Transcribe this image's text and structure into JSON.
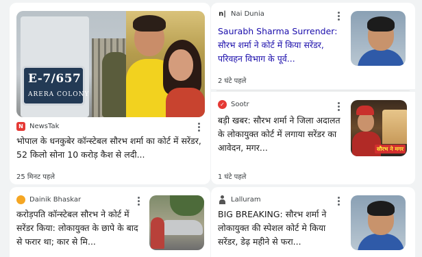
{
  "articles": [
    {
      "source": "NewsTak",
      "source_icon": "newstak-logo-icon",
      "headline": "भोपाल के धनकुबेर कॉन्स्टेबल सौरभ शर्मा का कोर्ट में सरेंडर, 52 किलो सोना 10 करोड़ कैश से लदी...",
      "time": "25 मिनट पहले",
      "image": {
        "plate_number": "E-7/657",
        "plate_text": "ARERA COLONY"
      }
    },
    {
      "source": "Nai Dunia",
      "source_icon": "naidunia-logo-icon",
      "headline": "Saurabh Sharma Surrender: सौरभ शर्मा ने कोर्ट में किया सरेंडर, परिवहन विभाग के पूर्व...",
      "time": "2 घंटे पहले"
    },
    {
      "source": "Sootr",
      "source_icon": "sootr-logo-icon",
      "headline": "बड़ी खबर: सौरभ शर्मा ने जिला अदालत के लोकायुक्त कोर्ट में लगाया सरेंडर का आवेदन, मगर...",
      "time": "1 घंटे पहले",
      "image": {
        "caption": "सौरभ ने मगर"
      }
    },
    {
      "source": "Dainik Bhaskar",
      "source_icon": "dainik-bhaskar-logo-icon",
      "headline": "करोड़पति कॉन्स्टेबल सौरभ ने कोर्ट में सरेंडर किया: लोकायुक्त के छापे के बाद से फरार था; कार से मि...",
      "time": ""
    },
    {
      "source": "Lalluram",
      "source_icon": "lalluram-logo-icon",
      "headline": "BIG BREAKING: सौरभ शर्मा ने लोकायुक्त की स्पेशल कोर्ट मे किया सरेंडर, डेढ़ महीने से फरा...",
      "time": ""
    }
  ],
  "colors": {
    "background": "#f1f3f4",
    "card": "#ffffff",
    "headline_link": "#1a0dab",
    "headline_text": "#1a1a1a",
    "meta_text": "#3c4043"
  }
}
